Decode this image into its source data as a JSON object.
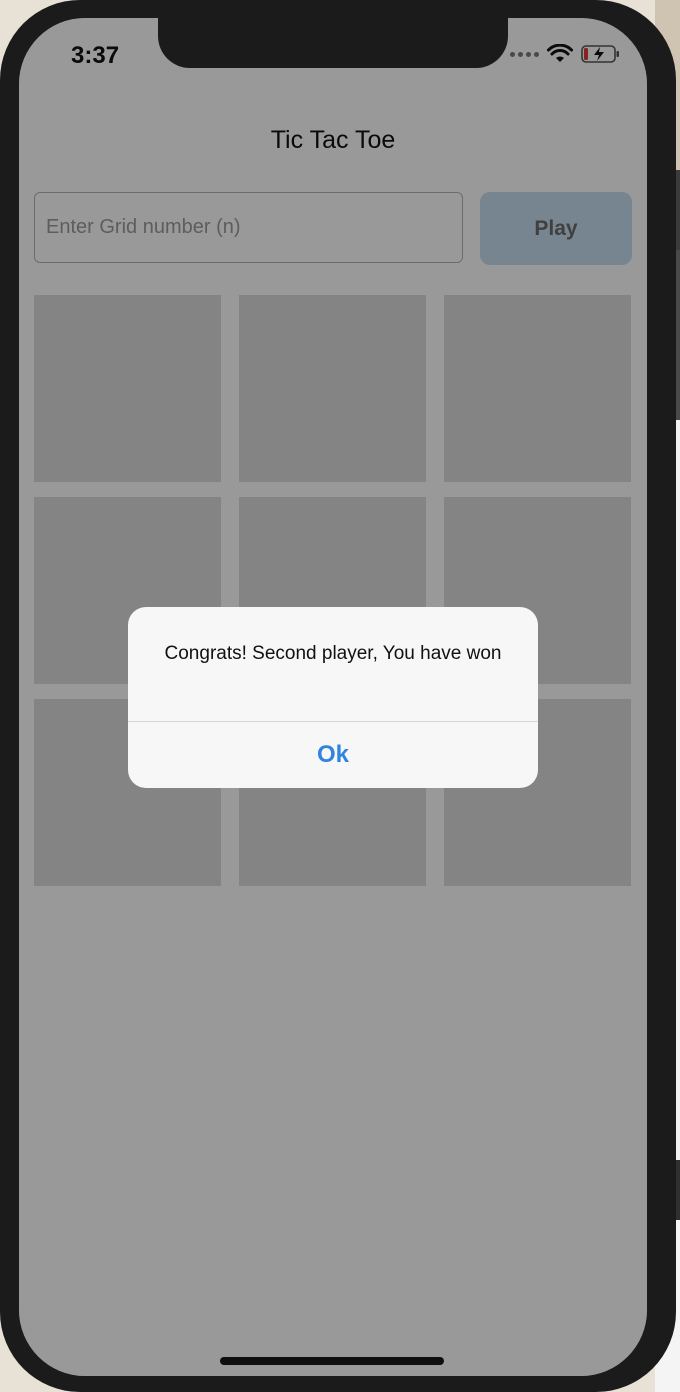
{
  "status_bar": {
    "time": "3:37",
    "icons": [
      "signal-dots-icon",
      "wifi-icon",
      "battery-charging-icon"
    ]
  },
  "app": {
    "title": "Tic Tac Toe",
    "grid_input": {
      "placeholder": "Enter Grid number (n)",
      "value": ""
    },
    "play_label": "Play",
    "board": {
      "rows": 3,
      "cols": 3,
      "cells": [
        "",
        "",
        "",
        "",
        "",
        "",
        "",
        "",
        ""
      ]
    }
  },
  "alert": {
    "message": "Congrats! Second player, You have won",
    "ok_label": "Ok"
  },
  "colors": {
    "accent": "#2f84e0",
    "play_button_bg": "#c6def2",
    "cell_bg": "#dcdcdc",
    "overlay": "rgba(0,0,0,0.4)"
  }
}
